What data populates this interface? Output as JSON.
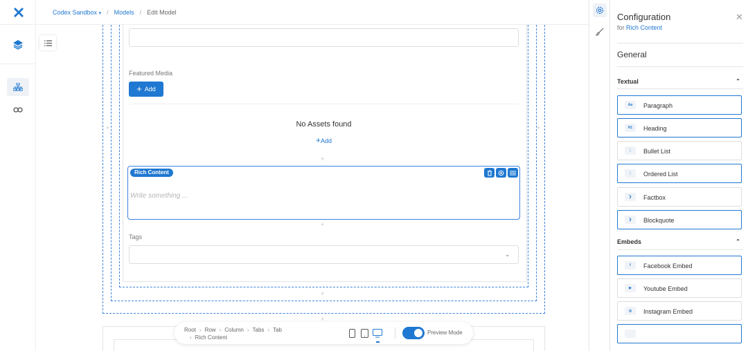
{
  "topbar": {
    "breadcrumb": [
      "Codex Sandbox",
      "Models",
      "Edit Model"
    ],
    "caret": "▾",
    "separator": "/"
  },
  "form": {
    "featured_media_label": "Featured Media",
    "add_button_label": "Add",
    "no_assets_text": "No Assets found",
    "add_link_label": "Add",
    "rich_content": {
      "tag": "Rich Content",
      "placeholder": "Write something ..."
    },
    "tags_label": "Tags",
    "tags_chevron": "⌄"
  },
  "bottom_bar": {
    "path": [
      "Root",
      "Row",
      "Column",
      "Tabs",
      "Tab",
      "Rich Content"
    ],
    "chevron": "›",
    "preview_mode_label": "Preview Mode",
    "preview_mode_on": true
  },
  "config_panel": {
    "title": "Configuration",
    "subtitle_prefix": "for",
    "subtitle_target": "Rich Content",
    "close_glyph": "✕",
    "section_general": "General",
    "textual": {
      "title": "Textual",
      "caret": "⌃",
      "items": [
        {
          "label": "Paragraph",
          "icon": "Aa",
          "highlighted": true
        },
        {
          "label": "Heading",
          "icon": "H1",
          "highlighted": true
        },
        {
          "label": "Bullet List",
          "icon": "⋮",
          "highlighted": false
        },
        {
          "label": "Ordered List",
          "icon": "⋮",
          "highlighted": true
        },
        {
          "label": "Factbox",
          "icon": "❯",
          "highlighted": false
        },
        {
          "label": "Blockquote",
          "icon": "❯",
          "highlighted": true
        }
      ]
    },
    "embeds": {
      "title": "Embeds",
      "caret": "⌃",
      "items": [
        {
          "label": "Facebook Embed",
          "icon": "f",
          "highlighted": true
        },
        {
          "label": "Youtube Embed",
          "icon": "▶",
          "highlighted": false
        },
        {
          "label": "Instagram Embed",
          "icon": "◎",
          "highlighted": false
        }
      ]
    }
  },
  "colors": {
    "accent": "#1f78d1",
    "dashed": "#3b82e0"
  }
}
